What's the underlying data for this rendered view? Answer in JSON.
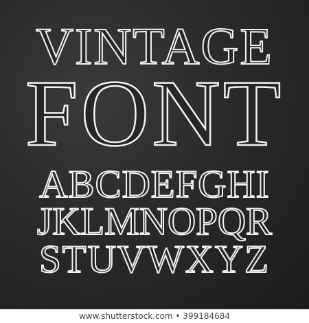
{
  "title": "VINTAGE",
  "subtitle": "FONT",
  "alphabet": [
    "ABCDEFGHI",
    "JKLMNOPQR",
    "STUVWXYZ"
  ],
  "watermark": "www.shutterstock.com • 399184684",
  "colors": {
    "background": "#2a2a2a",
    "letters": "#f2f2f2"
  }
}
